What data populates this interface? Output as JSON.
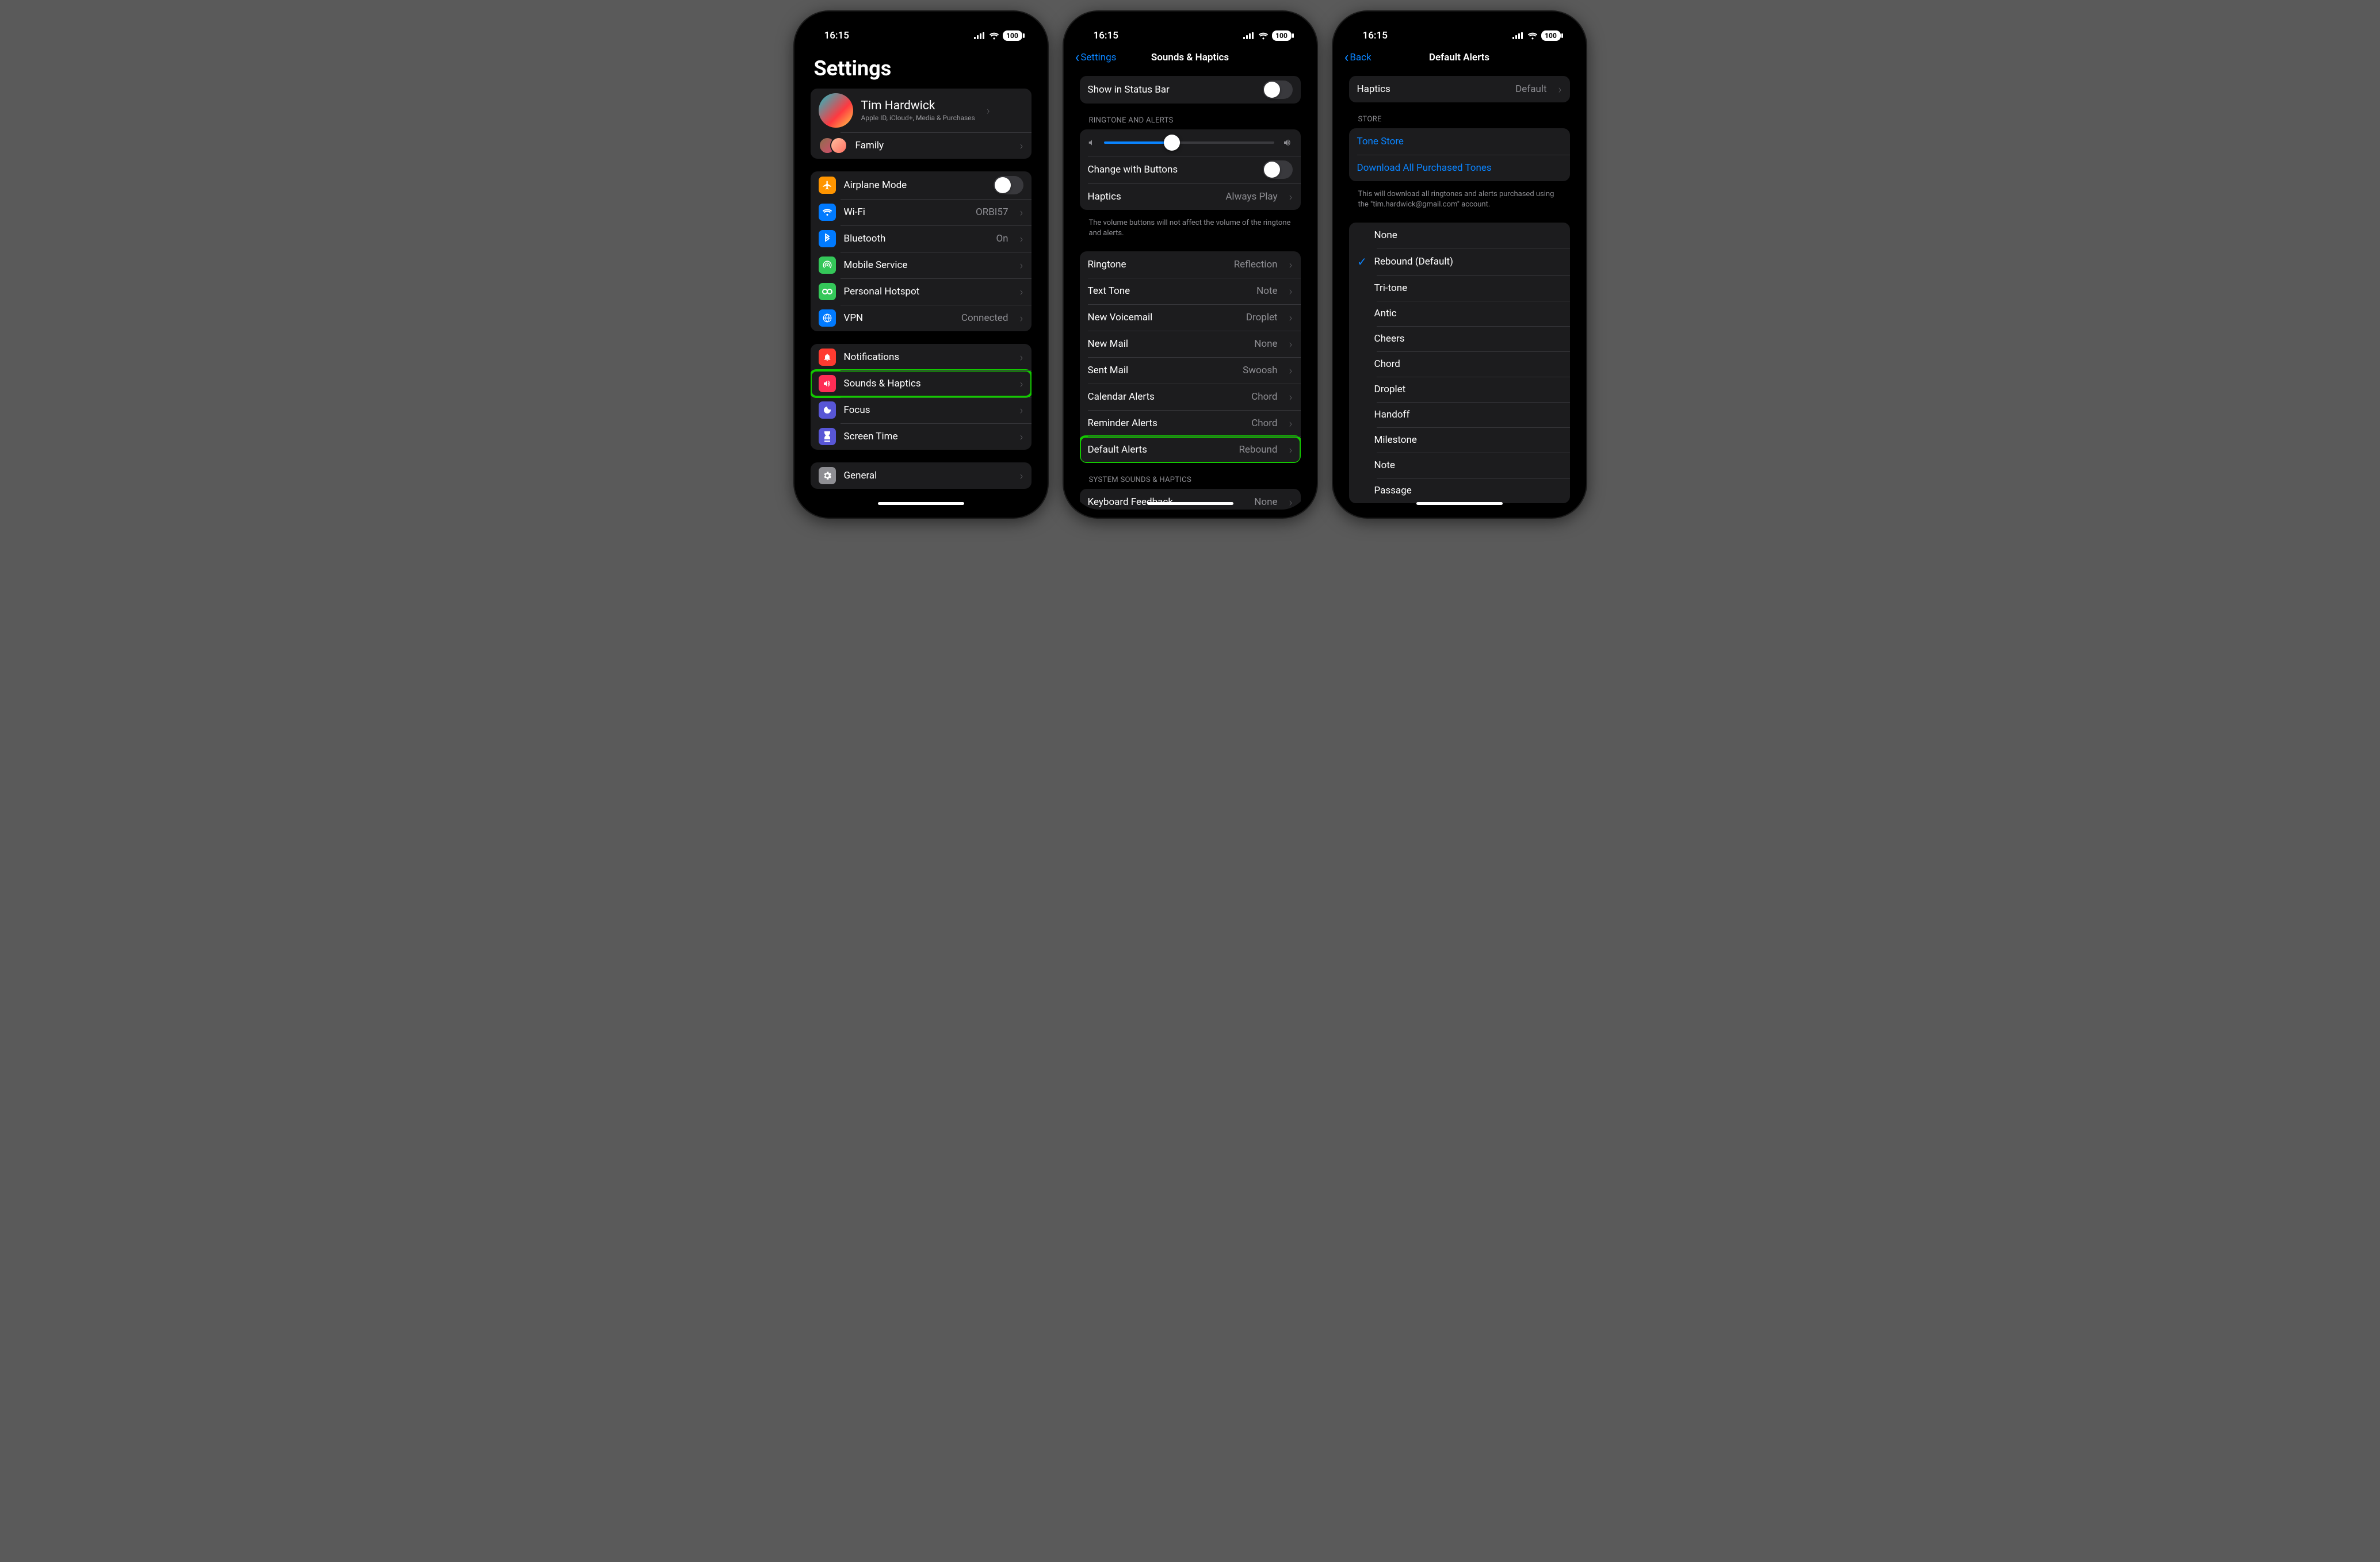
{
  "status": {
    "time": "16:15",
    "battery": "100"
  },
  "screen1": {
    "title": "Settings",
    "profile": {
      "name": "Tim Hardwick",
      "sub": "Apple ID, iCloud+, Media & Purchases",
      "family": "Family"
    },
    "g1": {
      "airplane": "Airplane Mode",
      "wifi": "Wi-Fi",
      "wifi_val": "ORBI57",
      "bt": "Bluetooth",
      "bt_val": "On",
      "mobile": "Mobile Service",
      "hotspot": "Personal Hotspot",
      "vpn": "VPN",
      "vpn_val": "Connected"
    },
    "g2": {
      "notif": "Notifications",
      "sounds": "Sounds & Haptics",
      "focus": "Focus",
      "screentime": "Screen Time"
    },
    "g3": {
      "general": "General"
    }
  },
  "screen2": {
    "back": "Settings",
    "title": "Sounds & Haptics",
    "show_status": "Show in Status Bar",
    "hdr_ringtone": "RINGTONE AND ALERTS",
    "change_btns": "Change with Buttons",
    "haptics": "Haptics",
    "haptics_val": "Always Play",
    "footer1": "The volume buttons will not affect the volume of the ringtone and alerts.",
    "tones": {
      "ringtone": "Ringtone",
      "ringtone_v": "Reflection",
      "text": "Text Tone",
      "text_v": "Note",
      "vm": "New Voicemail",
      "vm_v": "Droplet",
      "mail": "New Mail",
      "mail_v": "None",
      "sent": "Sent Mail",
      "sent_v": "Swoosh",
      "cal": "Calendar Alerts",
      "cal_v": "Chord",
      "rem": "Reminder Alerts",
      "rem_v": "Chord",
      "def": "Default Alerts",
      "def_v": "Rebound"
    },
    "hdr_sys": "SYSTEM SOUNDS & HAPTICS",
    "keyboard": "Keyboard Feedback",
    "keyboard_v": "None"
  },
  "screen3": {
    "back": "Back",
    "title": "Default Alerts",
    "haptics": "Haptics",
    "haptics_val": "Default",
    "hdr_store": "STORE",
    "store1": "Tone Store",
    "store2": "Download All Purchased Tones",
    "store_footer": "This will download all ringtones and alerts purchased using the \"tim.hardwick@gmail.com\" account.",
    "tones": [
      "None",
      "Rebound (Default)",
      "Tri-tone",
      "Antic",
      "Cheers",
      "Chord",
      "Droplet",
      "Handoff",
      "Milestone",
      "Note",
      "Passage"
    ],
    "selected_index": 1
  },
  "colors": {
    "orange": "#ff9500",
    "blue": "#007aff",
    "green": "#34c759",
    "btblue": "#0a7aff",
    "red": "#ff3b30",
    "pink": "#ff2d55",
    "indigo": "#5856d6",
    "grey": "#8e8e93"
  }
}
